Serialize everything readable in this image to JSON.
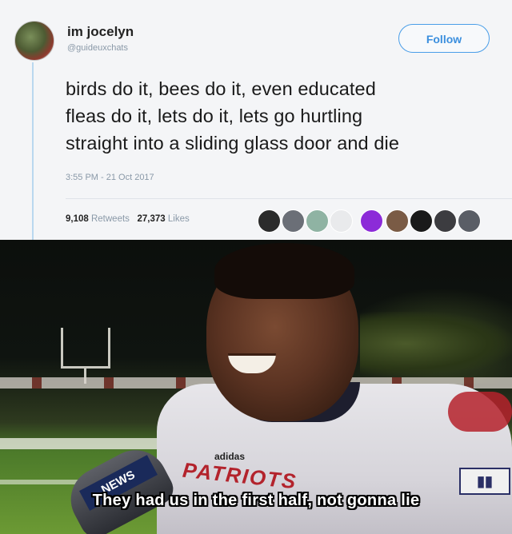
{
  "tweet": {
    "display_name": "im jocelyn",
    "handle": "@guideuxchats",
    "follow_label": "Follow",
    "text_lines": [
      "birds do it, bees do it, even educated",
      "fleas do it, lets do it, lets go hurtling",
      "straight into a sliding glass door and die"
    ],
    "timestamp": "3:55 PM - 21 Oct 2017",
    "retweets_count": "9,108",
    "retweets_label": "Retweets",
    "likes_count": "27,373",
    "likes_label": "Likes",
    "accent_color": "#3b8fde"
  },
  "photo": {
    "jersey_text": "PATRIOTS",
    "brand_text": "adidas",
    "mic_flag_text": "NEWS",
    "subtitle": "They had us in the first half, not gonna lie"
  }
}
